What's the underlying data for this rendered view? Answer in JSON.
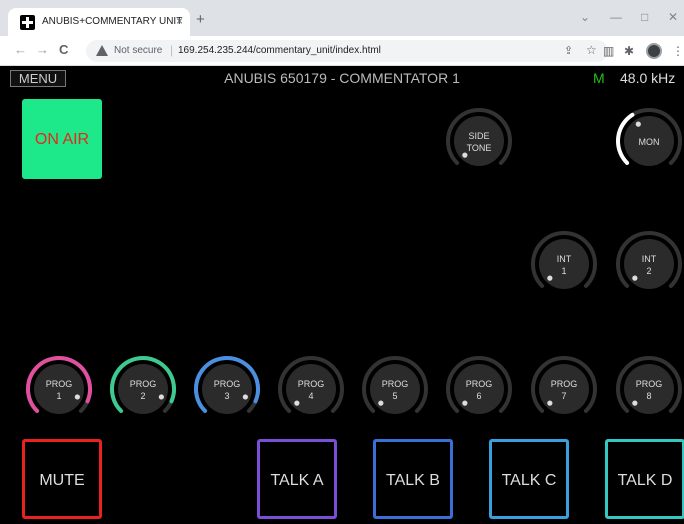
{
  "browser": {
    "tab_title": "ANUBIS+COMMENTARY UNIT",
    "tab_close": "×",
    "new_tab": "+",
    "window_controls": [
      "⌄",
      "—",
      "□",
      "✕"
    ],
    "nav": {
      "back": "←",
      "forward": "→",
      "reload": "C"
    },
    "security_label": "Not secure",
    "separator": "|",
    "url": "169.254.235.244/commentary_unit/index.html",
    "share_glyph": "⇪",
    "star_glyph": "☆",
    "reading_list_glyph": "▥",
    "extensions_glyph": "✱",
    "menu_glyph": "⋮"
  },
  "header": {
    "menu_label": "MENU",
    "title": "ANUBIS 650179 - COMMENTATOR 1",
    "mode_indicator": "M",
    "mode_color": "#1ec21e",
    "sample_rate": "48.0 kHz"
  },
  "on_air": {
    "label": "ON AIR",
    "bg_color": "#1de98b",
    "text_color": "#e5281a"
  },
  "knobs_top": [
    {
      "id": "side-tone",
      "line1": "SIDE",
      "line2": "TONE",
      "level": 0,
      "color": "#555555"
    },
    {
      "id": "mon",
      "line1": "MON",
      "line2": "",
      "level": 0.38,
      "color": "#ffffff"
    },
    {
      "id": "int-1",
      "line1": "INT",
      "line2": "1",
      "level": 0,
      "color": "#555555"
    },
    {
      "id": "int-2",
      "line1": "INT",
      "line2": "2",
      "level": 0,
      "color": "#555555"
    }
  ],
  "prog_knobs": [
    {
      "line1": "PROG",
      "line2": "1",
      "level": 0.92,
      "color": "#e0509f"
    },
    {
      "line1": "PROG",
      "line2": "2",
      "level": 0.92,
      "color": "#3ec990"
    },
    {
      "line1": "PROG",
      "line2": "3",
      "level": 0.92,
      "color": "#4a8fe0"
    },
    {
      "line1": "PROG",
      "line2": "4",
      "level": 0,
      "color": "#555555"
    },
    {
      "line1": "PROG",
      "line2": "5",
      "level": 0,
      "color": "#555555"
    },
    {
      "line1": "PROG",
      "line2": "6",
      "level": 0,
      "color": "#555555"
    },
    {
      "line1": "PROG",
      "line2": "7",
      "level": 0,
      "color": "#555555"
    },
    {
      "line1": "PROG",
      "line2": "8",
      "level": 0,
      "color": "#555555"
    }
  ],
  "pads": [
    {
      "id": "mute",
      "label": "MUTE",
      "color": "#e8231f"
    },
    {
      "id": "talk-a",
      "label": "TALK A",
      "color": "#7a4fd6"
    },
    {
      "id": "talk-b",
      "label": "TALK B",
      "color": "#3a6fd8"
    },
    {
      "id": "talk-c",
      "label": "TALK C",
      "color": "#3a9fdf"
    },
    {
      "id": "talk-d",
      "label": "TALK D",
      "color": "#33c9c2"
    }
  ]
}
